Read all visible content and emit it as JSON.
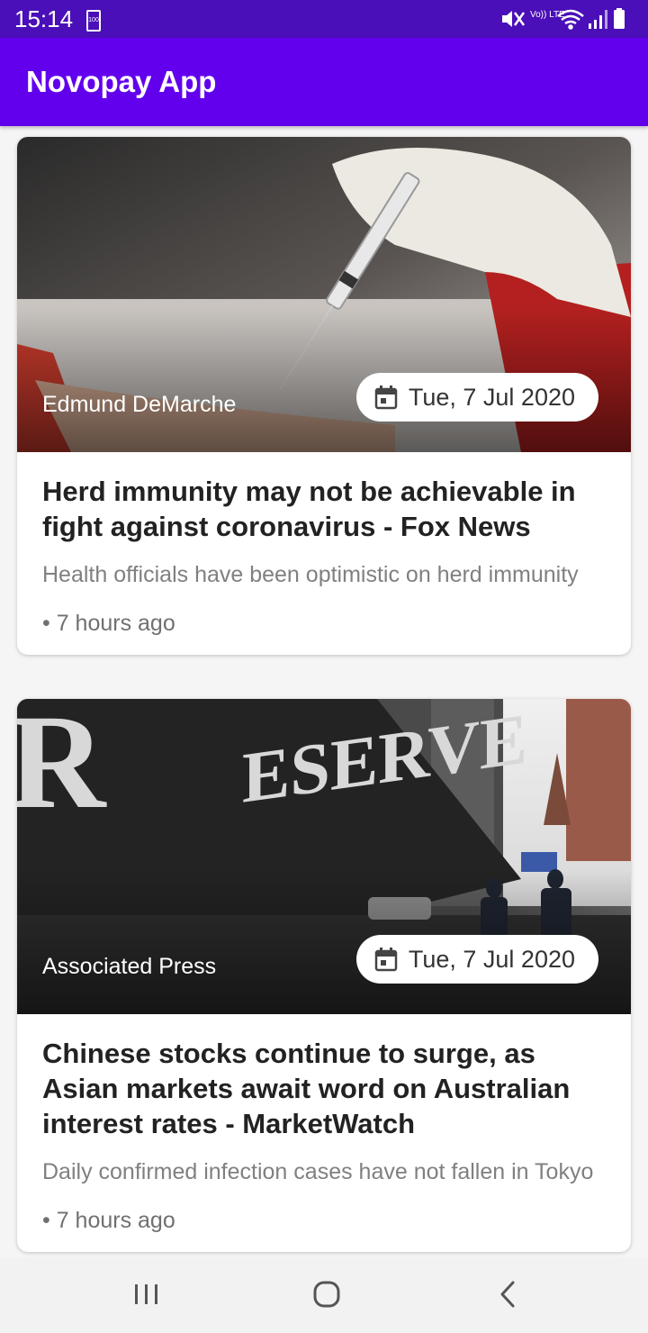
{
  "status_bar": {
    "time": "15:14",
    "battery_text": "100",
    "network_label": "Vo)) LTE"
  },
  "app_bar": {
    "title": "Novopay App"
  },
  "articles": [
    {
      "source": "Edmund DeMarche",
      "date": "Tue, 7 Jul 2020",
      "headline": "Herd immunity may not be achievable in fight against coronavirus - Fox News",
      "summary": "Health officials have been optimistic on herd immunity",
      "time_ago": "• 7 hours ago",
      "icon": "calendar-icon"
    },
    {
      "source": "Associated Press",
      "date": "Tue, 7 Jul 2020",
      "headline": "Chinese stocks continue to surge, as Asian markets await word on Australian interest rates - MarketWatch",
      "summary": "Daily confirmed infection cases have not fallen in Tokyo",
      "time_ago": "• 7 hours ago",
      "icon": "calendar-icon"
    }
  ],
  "nav_bar": {
    "icons": [
      "recent-apps-icon",
      "home-icon",
      "back-icon"
    ]
  },
  "colors": {
    "status_bar": "#4a0fb8",
    "app_bar": "#6200ee",
    "background": "#f5f5f5"
  }
}
